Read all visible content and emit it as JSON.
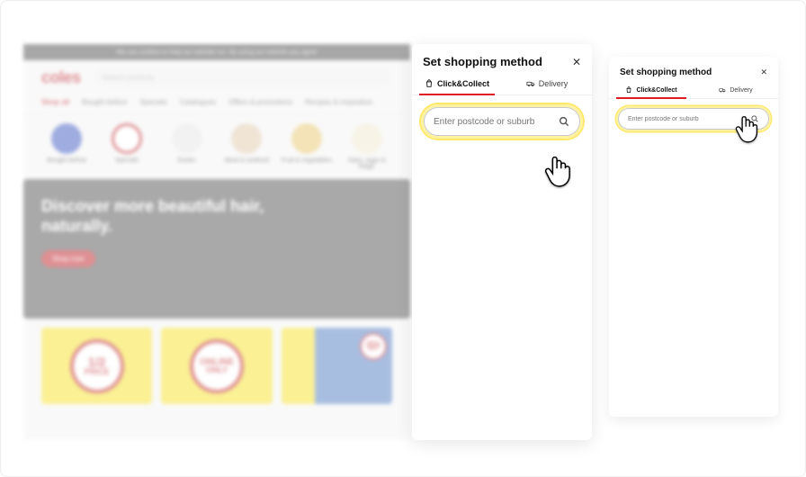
{
  "site": {
    "bar_text": "We use cookies to help our website run. By using our website you agree",
    "logo": "coles",
    "search_placeholder": "Search products",
    "nav": {
      "shop_all": "Shop all",
      "bought_before": "Bought before",
      "specials": "Specials",
      "catalogues": "Catalogues",
      "offers": "Offers & promotions",
      "recipes": "Recipes & inspiration"
    },
    "categories": [
      {
        "label": "Bought before",
        "color": "#3a5bdc"
      },
      {
        "label": "Specials",
        "color": "#ffffff"
      },
      {
        "label": "Easter",
        "color": "#e6e6e6"
      },
      {
        "label": "Meat & seafood",
        "color": "#e7c9a5"
      },
      {
        "label": "Fruit & vegetables",
        "color": "#f0c95b"
      },
      {
        "label": "Dairy, eggs & fridge",
        "color": "#f2e8c8"
      }
    ],
    "hero": {
      "title_line1": "Discover more beautiful hair,",
      "title_line2": "naturally.",
      "button": "Shop now"
    },
    "promos": {
      "half_price": {
        "l1": "1/2",
        "l2": "PRICE"
      },
      "online_only": {
        "l1": "ONLINE",
        "l2": "ONLY"
      },
      "badge": {
        "l1": "25%",
        "l2": "OFF"
      }
    }
  },
  "panel": {
    "title": "Set shopping method",
    "tabs": {
      "click_collect": "Click&Collect",
      "delivery": "Delivery"
    },
    "search_placeholder": "Enter postcode or suburb"
  }
}
